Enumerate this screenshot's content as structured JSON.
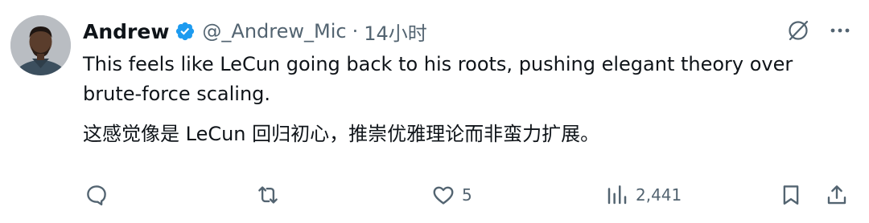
{
  "post": {
    "author_name": "Andrew",
    "author_handle": "@_Andrew_Mic",
    "separator": "·",
    "time": "14小时",
    "text_en": "This feels like LeCun going back to his roots, pushing elegant theory over brute-force scaling.",
    "text_zh": "这感觉像是 LeCun 回归初心，推崇优雅理论而非蛮力扩展。"
  },
  "actions": {
    "replies": "",
    "reposts": "",
    "likes": "5",
    "views": "2,441"
  },
  "icons": {
    "verified": "verified-badge-icon",
    "grok": "grok-icon",
    "more": "more-icon",
    "reply": "reply-icon",
    "repost": "repost-icon",
    "like": "heart-icon",
    "views": "views-icon",
    "bookmark": "bookmark-icon",
    "share": "share-icon"
  },
  "colors": {
    "text": "#0f1419",
    "secondary": "#536471",
    "verified": "#1d9bf0",
    "background": "#ffffff"
  }
}
